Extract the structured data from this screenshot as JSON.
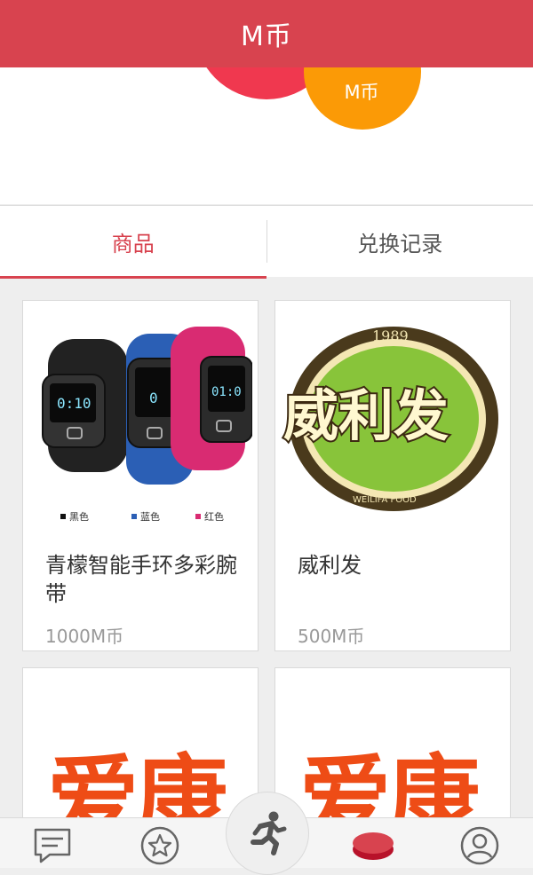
{
  "header": {
    "title": "M币"
  },
  "hero": {
    "coin_label": "M币"
  },
  "tabs": [
    {
      "label": "商品",
      "active": true
    },
    {
      "label": "兑换记录",
      "active": false
    }
  ],
  "products": [
    {
      "name": "青檬智能手环多彩腕带",
      "price": "1000M币",
      "image_colors": [
        "黑色",
        "蓝色",
        "红色"
      ]
    },
    {
      "name": "威利发",
      "price": "500M币",
      "logo_year": "1989",
      "logo_sub": "WEILIFA FOOD"
    },
    {
      "name": "",
      "price": "",
      "logo_text": "爱康"
    },
    {
      "name": "",
      "price": "",
      "logo_text": "爱康"
    }
  ],
  "bottom_nav": [
    {
      "icon": "message-icon"
    },
    {
      "icon": "star-icon"
    },
    {
      "icon": "runner-icon"
    },
    {
      "icon": "coin-icon"
    },
    {
      "icon": "user-icon"
    }
  ],
  "colors": {
    "accent": "#d8434f",
    "orange": "#fb9a06",
    "pink": "#f0384f"
  }
}
